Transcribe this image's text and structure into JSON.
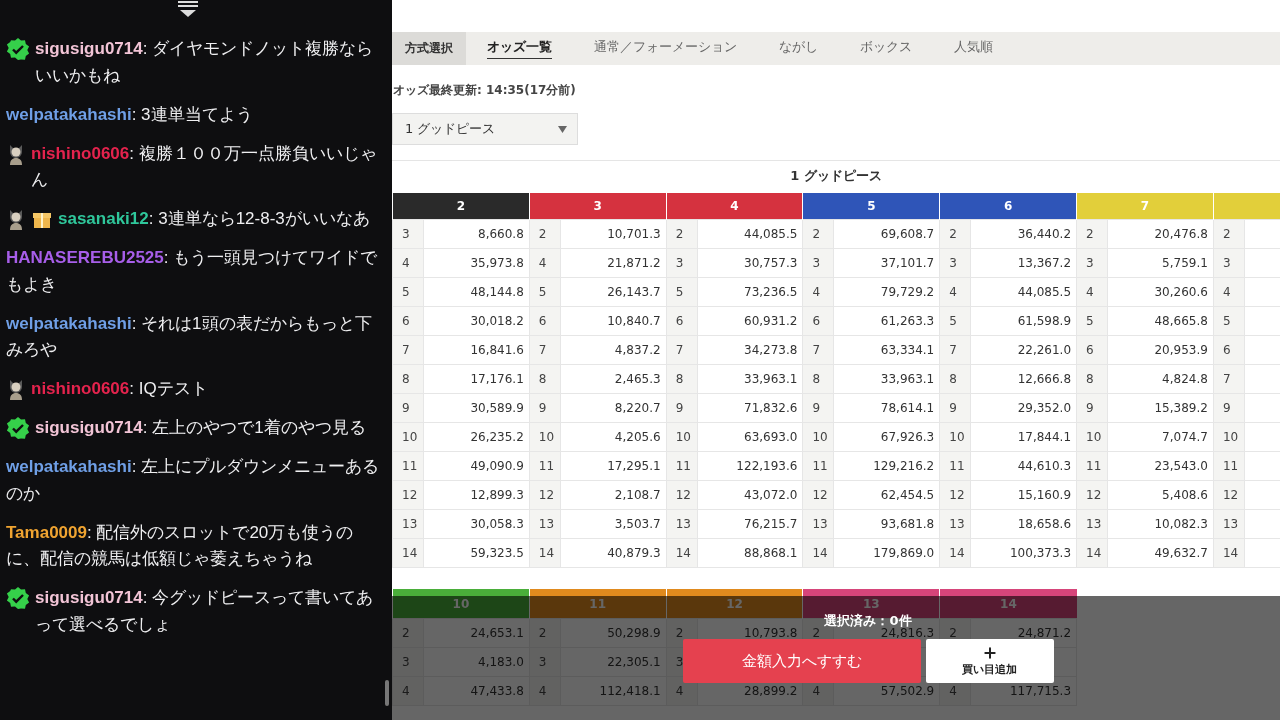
{
  "chat": {
    "messages": [
      {
        "user": "sigusigu0714",
        "color": "#f2c4d6",
        "badges": [
          {
            "kind": "verified"
          }
        ],
        "text": ": ダイヤモンドノット複勝ならいいかもね"
      },
      {
        "user": "welpatakahashi",
        "color": "#6f9fe6",
        "text": ": 3連単当てよう"
      },
      {
        "user": "nishino0606",
        "color": "#e4234d",
        "badges": [
          {
            "kind": "avatar"
          }
        ],
        "text": ": 複勝１００万一点勝負いいじゃん"
      },
      {
        "user": "sasanaki12",
        "color": "#2fc79b",
        "badges": [
          {
            "kind": "avatar"
          },
          {
            "kind": "gift"
          }
        ],
        "text": ": 3連単なら12-8-3がいいなあ"
      },
      {
        "user": "HANASEREBU2525",
        "color": "#a75ee9",
        "text": ": もう一頭見つけてワイドでもよき"
      },
      {
        "user": "welpatakahashi",
        "color": "#6f9fe6",
        "text": ": それは1頭の表だからもっと下みろや"
      },
      {
        "user": "nishino0606",
        "color": "#e4234d",
        "badges": [
          {
            "kind": "avatar"
          }
        ],
        "text": ": IQテスト"
      },
      {
        "user": "sigusigu0714",
        "color": "#f2c4d6",
        "badges": [
          {
            "kind": "verified"
          }
        ],
        "text": ": 左上のやつで1着のやつ見る"
      },
      {
        "user": "welpatakahashi",
        "color": "#6f9fe6",
        "text": ": 左上にプルダウンメニューあるのか"
      },
      {
        "user": "Tama0009",
        "color": "#f0a431",
        "text": ": 配信外のスロットで20万も使うのに、配信の競馬は低額じゃ萎えちゃうね"
      },
      {
        "user": "sigusigu0714",
        "color": "#f2c4d6",
        "badges": [
          {
            "kind": "verified"
          }
        ],
        "text": ": 今グッドピースって書いてあって選べるでしょ"
      }
    ]
  },
  "odds_page": {
    "method_label": "方式選択",
    "tabs": [
      {
        "label": "オッズ一覧",
        "selected": true
      },
      {
        "label": "通常／フォーメーション",
        "selected": false
      },
      {
        "label": "ながし",
        "selected": false
      },
      {
        "label": "ボックス",
        "selected": false
      },
      {
        "label": "人気順",
        "selected": false
      }
    ],
    "updated": "オッズ最終更新: 14:35(17分前)",
    "horse_select": {
      "value": "1 グッドピース"
    },
    "table_title": "1 グッドピース",
    "table": {
      "columns": [
        {
          "header": "2",
          "color": "#2a2a2a",
          "rows": [
            {
              "num": "3",
              "odds": "8,660.8"
            },
            {
              "num": "4",
              "odds": "35,973.8"
            },
            {
              "num": "5",
              "odds": "48,144.8"
            },
            {
              "num": "6",
              "odds": "30,018.2"
            },
            {
              "num": "7",
              "odds": "16,841.6"
            },
            {
              "num": "8",
              "odds": "17,176.1"
            },
            {
              "num": "9",
              "odds": "30,589.9"
            },
            {
              "num": "10",
              "odds": "26,235.2"
            },
            {
              "num": "11",
              "odds": "49,090.9"
            },
            {
              "num": "12",
              "odds": "12,899.3"
            },
            {
              "num": "13",
              "odds": "30,058.3"
            },
            {
              "num": "14",
              "odds": "59,323.5"
            }
          ]
        },
        {
          "header": "3",
          "color": "#d5323f",
          "rows": [
            {
              "num": "2",
              "odds": "10,701.3"
            },
            {
              "num": "4",
              "odds": "21,871.2"
            },
            {
              "num": "5",
              "odds": "26,143.7"
            },
            {
              "num": "6",
              "odds": "10,840.7"
            },
            {
              "num": "7",
              "odds": "4,837.2"
            },
            {
              "num": "8",
              "odds": "2,465.3"
            },
            {
              "num": "9",
              "odds": "8,220.7"
            },
            {
              "num": "10",
              "odds": "4,205.6"
            },
            {
              "num": "11",
              "odds": "17,295.1"
            },
            {
              "num": "12",
              "odds": "2,108.7"
            },
            {
              "num": "13",
              "odds": "3,503.7"
            },
            {
              "num": "14",
              "odds": "40,879.3"
            }
          ]
        },
        {
          "header": "4",
          "color": "#d5323f",
          "rows": [
            {
              "num": "2",
              "odds": "44,085.5"
            },
            {
              "num": "3",
              "odds": "30,757.3"
            },
            {
              "num": "5",
              "odds": "73,236.5"
            },
            {
              "num": "6",
              "odds": "60,931.2"
            },
            {
              "num": "7",
              "odds": "34,273.8"
            },
            {
              "num": "8",
              "odds": "33,963.1"
            },
            {
              "num": "9",
              "odds": "71,832.6"
            },
            {
              "num": "10",
              "odds": "63,693.0"
            },
            {
              "num": "11",
              "odds": "122,193.6"
            },
            {
              "num": "12",
              "odds": "43,072.0"
            },
            {
              "num": "13",
              "odds": "76,215.7"
            },
            {
              "num": "14",
              "odds": "88,868.1"
            }
          ]
        },
        {
          "header": "5",
          "color": "#2f55b8",
          "rows": [
            {
              "num": "2",
              "odds": "69,608.7"
            },
            {
              "num": "3",
              "odds": "37,101.7"
            },
            {
              "num": "4",
              "odds": "79,729.2"
            },
            {
              "num": "6",
              "odds": "61,263.3"
            },
            {
              "num": "7",
              "odds": "63,334.1"
            },
            {
              "num": "8",
              "odds": "33,963.1"
            },
            {
              "num": "9",
              "odds": "78,614.1"
            },
            {
              "num": "10",
              "odds": "67,926.3"
            },
            {
              "num": "11",
              "odds": "129,216.2"
            },
            {
              "num": "12",
              "odds": "62,454.5"
            },
            {
              "num": "13",
              "odds": "93,681.8"
            },
            {
              "num": "14",
              "odds": "179,869.0"
            }
          ]
        },
        {
          "header": "6",
          "color": "#2f55b8",
          "rows": [
            {
              "num": "2",
              "odds": "36,440.2"
            },
            {
              "num": "3",
              "odds": "13,367.2"
            },
            {
              "num": "4",
              "odds": "44,085.5"
            },
            {
              "num": "5",
              "odds": "61,598.9"
            },
            {
              "num": "7",
              "odds": "22,261.0"
            },
            {
              "num": "8",
              "odds": "12,666.8"
            },
            {
              "num": "9",
              "odds": "29,352.0"
            },
            {
              "num": "10",
              "odds": "17,844.1"
            },
            {
              "num": "11",
              "odds": "44,610.3"
            },
            {
              "num": "12",
              "odds": "15,160.9"
            },
            {
              "num": "13",
              "odds": "18,658.6"
            },
            {
              "num": "14",
              "odds": "100,373.3"
            }
          ]
        },
        {
          "header": "7",
          "color": "#e2cf3a",
          "rows": [
            {
              "num": "2",
              "odds": "20,476.8"
            },
            {
              "num": "3",
              "odds": "5,759.1"
            },
            {
              "num": "4",
              "odds": "30,260.6"
            },
            {
              "num": "5",
              "odds": "48,665.8"
            },
            {
              "num": "6",
              "odds": "20,953.9"
            },
            {
              "num": "8",
              "odds": "4,824.8"
            },
            {
              "num": "9",
              "odds": "15,389.2"
            },
            {
              "num": "10",
              "odds": "7,074.7"
            },
            {
              "num": "11",
              "odds": "23,543.0"
            },
            {
              "num": "12",
              "odds": "5,408.6"
            },
            {
              "num": "13",
              "odds": "10,082.3"
            },
            {
              "num": "14",
              "odds": "49,632.7"
            }
          ]
        },
        {
          "color": "#e2cf3a",
          "rows": [
            {
              "num": "2"
            },
            {
              "num": "3"
            },
            {
              "num": "4"
            },
            {
              "num": "5"
            },
            {
              "num": "6"
            },
            {
              "num": "7"
            },
            {
              "num": "9"
            },
            {
              "num": "10"
            },
            {
              "num": "11"
            },
            {
              "num": "12"
            },
            {
              "num": "13"
            },
            {
              "num": "14"
            }
          ]
        }
      ]
    },
    "table_2": {
      "columns": [
        {
          "header": "10",
          "color": "#4aae3a",
          "rows": [
            {
              "num": "2",
              "odds": "24,653.1"
            },
            {
              "num": "3",
              "odds": "4,183.0"
            },
            {
              "num": "4",
              "odds": "47,433.8"
            }
          ]
        },
        {
          "header": "11",
          "color": "#e08a1e",
          "rows": [
            {
              "num": "2",
              "odds": "50,298.9"
            },
            {
              "num": "3",
              "odds": "22,305.1"
            },
            {
              "num": "4",
              "odds": "112,418.1"
            }
          ]
        },
        {
          "header": "12",
          "color": "#e08a1e",
          "rows": [
            {
              "num": "2",
              "odds": "10,793.8"
            },
            {
              "num": "3"
            },
            {
              "num": "4",
              "odds": "28,899.2"
            }
          ]
        },
        {
          "header": "13",
          "color": "#d6457a",
          "rows": [
            {
              "num": "2",
              "odds": "24,816.3"
            },
            {},
            {
              "num": "4",
              "odds": "57,502.9"
            }
          ]
        },
        {
          "header": "14",
          "color": "#d6457a",
          "rows": [
            {
              "num": "2",
              "odds": "24,871.2"
            },
            {},
            {
              "num": "4",
              "odds": "117,715.3"
            }
          ]
        }
      ]
    },
    "selection": {
      "count_label": "選択済み：0件",
      "proceed_button": "金額入力へすすむ",
      "add_button": "買い目追加"
    }
  }
}
